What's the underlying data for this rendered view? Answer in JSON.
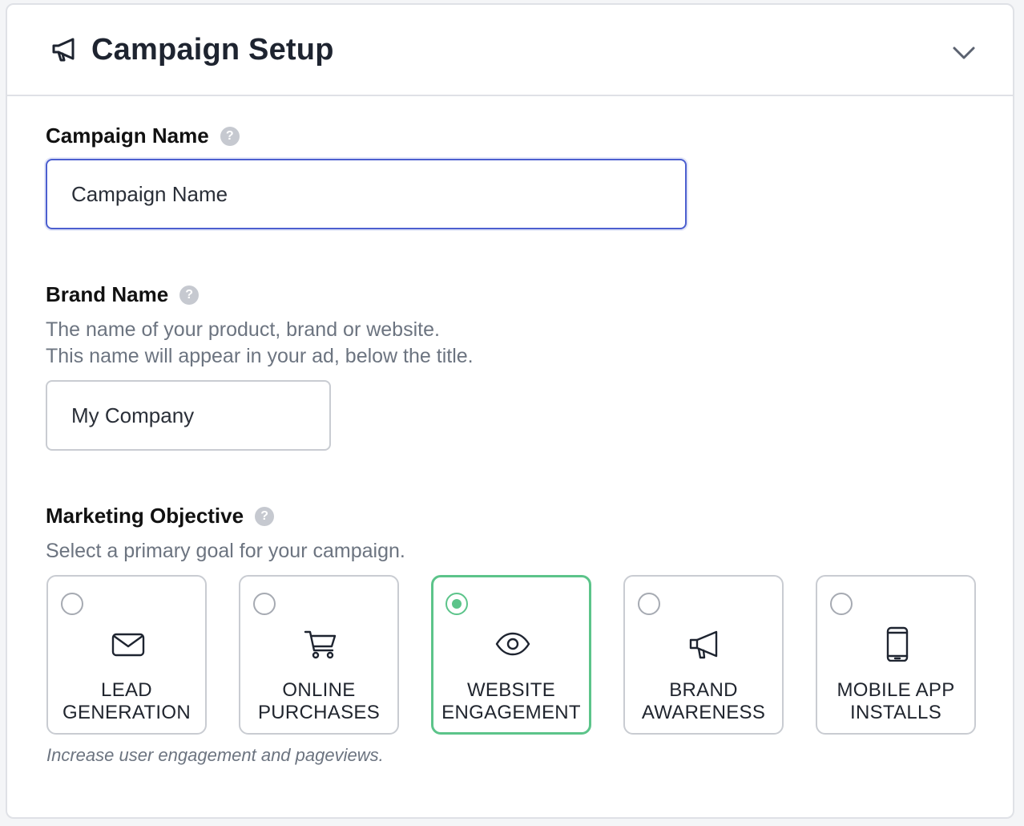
{
  "header": {
    "title": "Campaign Setup",
    "icon": "megaphone-icon",
    "collapse_icon": "chevron-down-icon"
  },
  "campaign_name": {
    "label": "Campaign Name",
    "value": "Campaign Name"
  },
  "brand_name": {
    "label": "Brand Name",
    "hint_line1": "The name of your product, brand or website.",
    "hint_line2": "This name will appear in your ad, below the title.",
    "value": "My Company"
  },
  "marketing_objective": {
    "label": "Marketing Objective",
    "hint": "Select a primary goal for your campaign.",
    "selected": "website-engagement",
    "options": [
      {
        "id": "lead-generation",
        "label": "LEAD\nGENERATION",
        "icon": "envelope-icon"
      },
      {
        "id": "online-purchases",
        "label": "ONLINE\nPURCHASES",
        "icon": "cart-icon"
      },
      {
        "id": "website-engagement",
        "label": "WEBSITE\nENGAGEMENT",
        "icon": "eye-icon"
      },
      {
        "id": "brand-awareness",
        "label": "BRAND\nAWARENESS",
        "icon": "megaphone-icon"
      },
      {
        "id": "mobile-app-installs",
        "label": "MOBILE APP\nINSTALLS",
        "icon": "phone-icon"
      }
    ],
    "description": "Increase user engagement and pageviews."
  },
  "help_icon_glyph": "?",
  "colors": {
    "accent_selected": "#5cc48a",
    "focus_border": "#4c5fcf",
    "hint_text": "#6c7480"
  }
}
